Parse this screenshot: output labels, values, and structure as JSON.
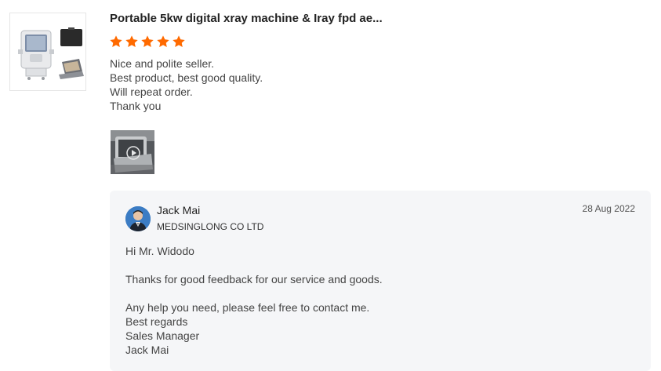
{
  "product": {
    "title": "Portable 5kw digital xray machine & Iray fpd ae...",
    "thumbnail_icon": "xray-machine-product-image"
  },
  "review": {
    "rating": 5,
    "rating_max": 5,
    "star_color": "#ff6a00",
    "lines": [
      "Nice and polite seller.",
      "Best product, best good quality.",
      "Will repeat order.",
      "Thank you"
    ],
    "photo_icon": "review-photo-thumbnail"
  },
  "reply": {
    "seller_name": "Jack Mai",
    "company": "MEDSINGLONG CO LTD",
    "date": "28 Aug 2022",
    "lines": [
      "Hi Mr. Widodo",
      "",
      "Thanks for good feedback for our service and goods.",
      "",
      "Any help you need, please feel free to contact me.",
      "Best regards",
      "Sales Manager",
      "Jack Mai"
    ],
    "background": "#f5f6f8"
  }
}
